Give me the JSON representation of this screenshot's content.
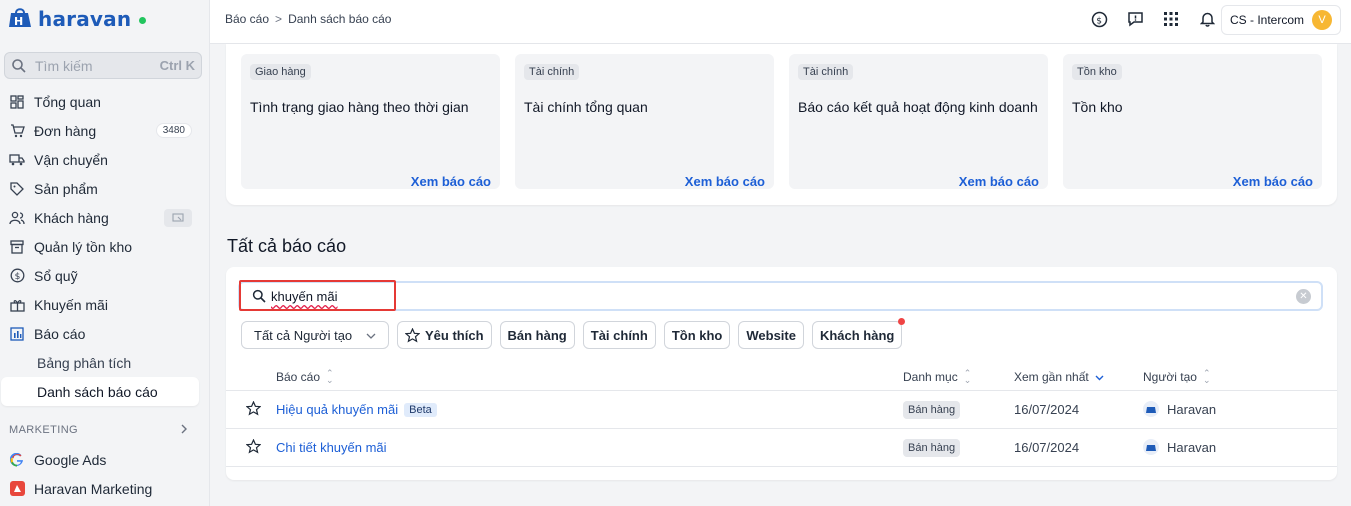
{
  "brand": {
    "name": "haravan"
  },
  "search": {
    "placeholder": "Tìm kiếm",
    "shortcut": "Ctrl K"
  },
  "sidebar": {
    "items": [
      {
        "label": "Tổng quan",
        "icon": "dashboard-icon"
      },
      {
        "label": "Đơn hàng",
        "icon": "cart-icon",
        "badge": "3480"
      },
      {
        "label": "Vận chuyển",
        "icon": "truck-icon"
      },
      {
        "label": "Sản phẩm",
        "icon": "tag-icon"
      },
      {
        "label": "Khách hàng",
        "icon": "users-icon"
      },
      {
        "label": "Quản lý tồn kho",
        "icon": "archive-icon"
      },
      {
        "label": "Sổ quỹ",
        "icon": "dollar-icon"
      },
      {
        "label": "Khuyến mãi",
        "icon": "gift-icon"
      },
      {
        "label": "Báo cáo",
        "icon": "bar-chart-icon"
      }
    ],
    "sub_items": [
      {
        "label": "Bảng phân tích"
      },
      {
        "label": "Danh sách báo cáo"
      }
    ],
    "marketing_label": "MARKETING",
    "marketing_items": [
      {
        "label": "Google Ads",
        "icon": "google-icon"
      },
      {
        "label": "Haravan Marketing",
        "icon": "haravan-marketing-icon"
      }
    ]
  },
  "topbar": {
    "breadcrumb": [
      "Báo cáo",
      "Danh sách báo cáo"
    ],
    "breadcrumb_sep": ">",
    "icons": [
      "clock-dollar-icon",
      "message-icon",
      "apps-grid-icon",
      "bell-icon"
    ],
    "account": {
      "name": "CS - Intercom",
      "initial": "V"
    }
  },
  "featured_reports": [
    {
      "tag": "Giao hàng",
      "title": "Tình trạng giao hàng theo thời gian",
      "link": "Xem báo cáo"
    },
    {
      "tag": "Tài chính",
      "title": "Tài chính tổng quan",
      "link": "Xem báo cáo"
    },
    {
      "tag": "Tài chính",
      "title": "Báo cáo kết quả hoạt động kinh doanh",
      "link": "Xem báo cáo"
    },
    {
      "tag": "Tồn kho",
      "title": "Tồn kho",
      "link": "Xem báo cáo"
    }
  ],
  "all_reports": {
    "title": "Tất cả báo cáo",
    "search_value": "khuyến mãi",
    "filters": {
      "creator_select": "Tất cả Người tạo",
      "chips": [
        "Yêu thích",
        "Bán hàng",
        "Tài chính",
        "Tồn kho",
        "Website",
        "Khách hàng"
      ]
    },
    "columns": [
      "Báo cáo",
      "Danh mục",
      "Xem gần nhất",
      "Người tạo"
    ],
    "rows": [
      {
        "name": "Hiệu quả khuyến mãi",
        "badge": "Beta",
        "category": "Bán hàng",
        "last_viewed": "16/07/2024",
        "creator": "Haravan"
      },
      {
        "name": "Chi tiết khuyến mãi",
        "badge": "",
        "category": "Bán hàng",
        "last_viewed": "16/07/2024",
        "creator": "Haravan"
      }
    ]
  },
  "colors": {
    "accent": "#1d5fd6",
    "brand": "#1e5bb8",
    "highlight_border": "#e53935",
    "avatar": "#f7b733",
    "online": "#22c55e"
  }
}
